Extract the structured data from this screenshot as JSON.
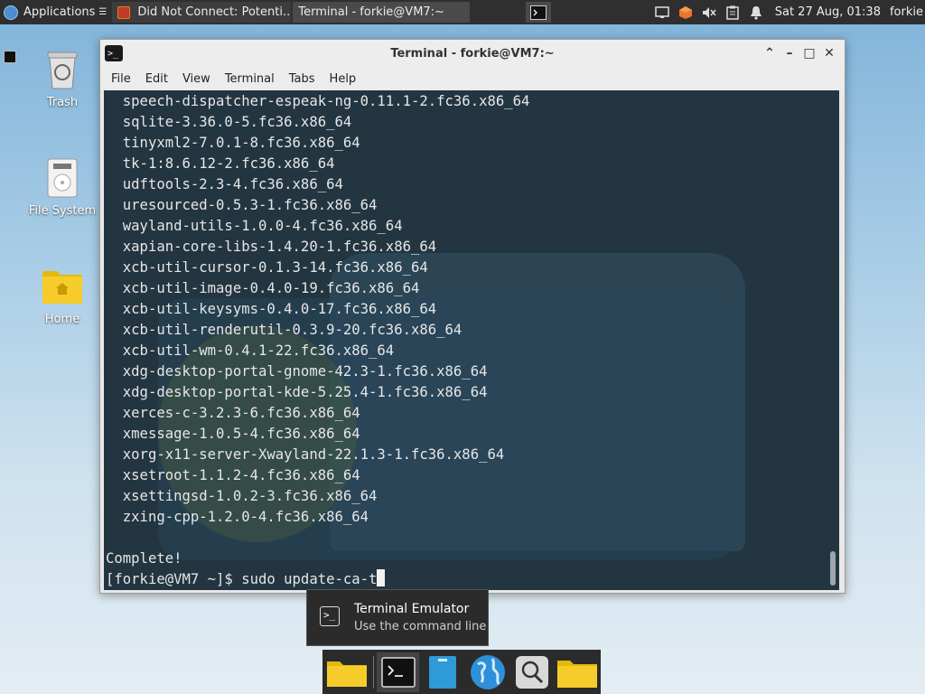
{
  "panel": {
    "applications_label": "Applications",
    "tasks": [
      {
        "label": "Did Not Connect: Potenti..."
      },
      {
        "label": "Terminal - forkie@VM7:~"
      }
    ],
    "clock": "Sat 27 Aug, 01:38",
    "user": "forkie"
  },
  "desktop": {
    "icons": [
      {
        "label": "Trash"
      },
      {
        "label": "File System"
      },
      {
        "label": "Home"
      }
    ]
  },
  "window": {
    "title": "Terminal - forkie@VM7:~",
    "menu": [
      "File",
      "Edit",
      "View",
      "Terminal",
      "Tabs",
      "Help"
    ],
    "terminal_lines": [
      "  speech-dispatcher-espeak-ng-0.11.1-2.fc36.x86_64",
      "  sqlite-3.36.0-5.fc36.x86_64",
      "  tinyxml2-7.0.1-8.fc36.x86_64",
      "  tk-1:8.6.12-2.fc36.x86_64",
      "  udftools-2.3-4.fc36.x86_64",
      "  uresourced-0.5.3-1.fc36.x86_64",
      "  wayland-utils-1.0.0-4.fc36.x86_64",
      "  xapian-core-libs-1.4.20-1.fc36.x86_64",
      "  xcb-util-cursor-0.1.3-14.fc36.x86_64",
      "  xcb-util-image-0.4.0-19.fc36.x86_64",
      "  xcb-util-keysyms-0.4.0-17.fc36.x86_64",
      "  xcb-util-renderutil-0.3.9-20.fc36.x86_64",
      "  xcb-util-wm-0.4.1-22.fc36.x86_64",
      "  xdg-desktop-portal-gnome-42.3-1.fc36.x86_64",
      "  xdg-desktop-portal-kde-5.25.4-1.fc36.x86_64",
      "  xerces-c-3.2.3-6.fc36.x86_64",
      "  xmessage-1.0.5-4.fc36.x86_64",
      "  xorg-x11-server-Xwayland-22.1.3-1.fc36.x86_64",
      "  xsetroot-1.1.2-4.fc36.x86_64",
      "  xsettingsd-1.0.2-3.fc36.x86_64",
      "  zxing-cpp-1.2.0-4.fc36.x86_64",
      "",
      "Complete!"
    ],
    "prompt": "[forkie@VM7 ~]$ ",
    "command": "sudo update-ca-t"
  },
  "tooltip": {
    "title": "Terminal Emulator",
    "subtitle": "Use the command line"
  },
  "icons": {
    "firefox": "firefox-icon",
    "terminal": "terminal-icon",
    "trash": "trash-icon",
    "filesystem": "drive-icon",
    "home": "home-folder-icon"
  }
}
